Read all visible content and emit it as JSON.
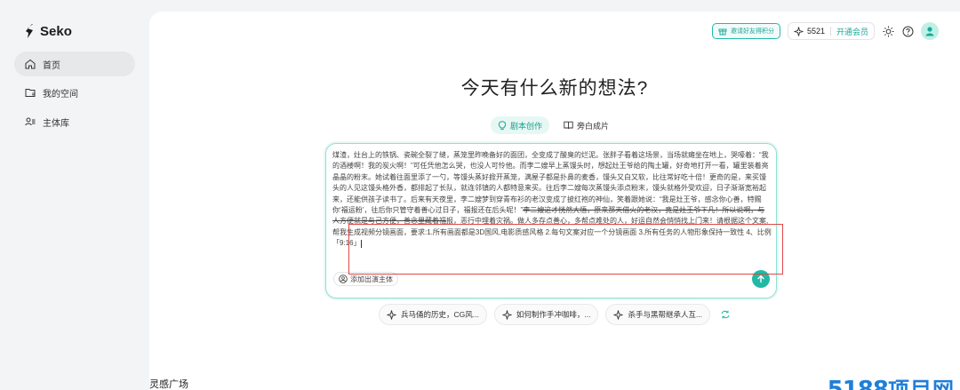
{
  "app": {
    "name": "Seko"
  },
  "sidebar": {
    "items": [
      {
        "label": "首页",
        "icon": "home-icon",
        "active": true
      },
      {
        "label": "我的空间",
        "icon": "folder-icon",
        "active": false
      },
      {
        "label": "主体库",
        "icon": "people-library-icon",
        "active": false
      }
    ]
  },
  "topbar": {
    "invite_label": "邀请好友得积分",
    "points": "5521",
    "member_label": "开通会员"
  },
  "main": {
    "headline": "今天有什么新的想法?",
    "tabs": [
      {
        "label": "剧本创作",
        "icon": "lightbulb-icon",
        "active": true
      },
      {
        "label": "旁白成片",
        "icon": "book-icon",
        "active": false
      }
    ],
    "prompt": {
      "text_before": "煤渣，灶台上的铁锅、瓷碗全裂了缝，蒸笼里昨晚备好的面团，全变成了酸臭的烂泥。张胖子看着这场景，当场就瘫坐在地上，哭嚎着：“我的酒楼啊！我的炭火啊！”可任凭他怎么哭，也没人可怜他。而李二嫂早上蒸馒头时，想起灶王爷给的陶土罐，好奇地打开一看，罐里装着亮晶晶的粉末。她试着往面里添了一勺，等馒头蒸好掀开蒸笼，满屋子都是扑鼻的麦香，馒头又白又软，比往常好吃十倍！更奇的是，来买馒头的人见这馒头格外香，都排起了长队，就连邻镇的人都特意来买。往后李二嫂每次蒸馒头添点粉末，馒头就格外受欢迎，日子渐渐宽裕起来，还能供孩子读书了。后来有天夜里，李二嫂梦到穿青布衫的老汉变成了披红袍的神仙，笑着跟她说：“我是灶王爷，感念你心善，特赐你‘福运粉’，往后你只管守着善心过日子，福报还在后头呢！”",
      "text_struck": "李二嫂这才恍然大悟，原来那天借火的老汉，竟是灶王爷下凡！所以说啊，与人方便就是与己方便，善念里藏着福",
      "text_after": "报，恶行中埋着灾祸。做人多存点善心，多帮点难处的人，好运自然会悄悄找上门来！请根据这个文案,帮我生成视频分镜画面，要求:1.所有画面都是3D国风,电影质感风格 2.每句文案对应一个分镜画面 3.所有任务的人物形象保持一致性 4、比例「9:16」",
      "add_subject_label": "添加出演主体"
    },
    "suggestions": [
      "兵马俑的历史，CG风...",
      "如何制作手冲咖啡，...",
      "杀手与黑帮继承人互..."
    ],
    "gallery_title": "灵感广场"
  },
  "watermark": {
    "number": "5188",
    "text": "项目网"
  },
  "colors": {
    "accent": "#21b9a6",
    "highlight_box": "#e04848",
    "watermark": "#1e7fd8"
  }
}
